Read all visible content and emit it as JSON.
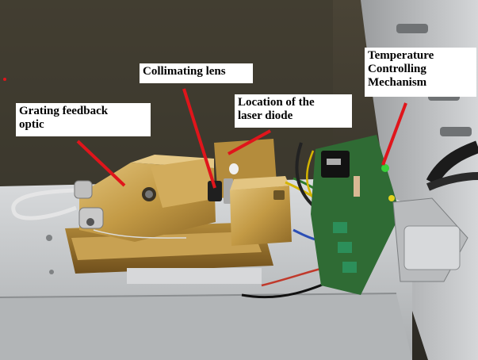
{
  "labels": {
    "grating": "Grating feedback\noptic",
    "lens": "Collimating lens",
    "diode": "Location of the\nlaser diode",
    "temperature": "Temperature\nControlling\nMechanism"
  },
  "colors": {
    "pointer": "#e0151b",
    "label_bg": "#ffffff",
    "label_text": "#000000",
    "brass": "#c9a24e",
    "pcb": "#2f6b34",
    "steel": "#c8cacc",
    "background_wall": "#3f3a30"
  }
}
